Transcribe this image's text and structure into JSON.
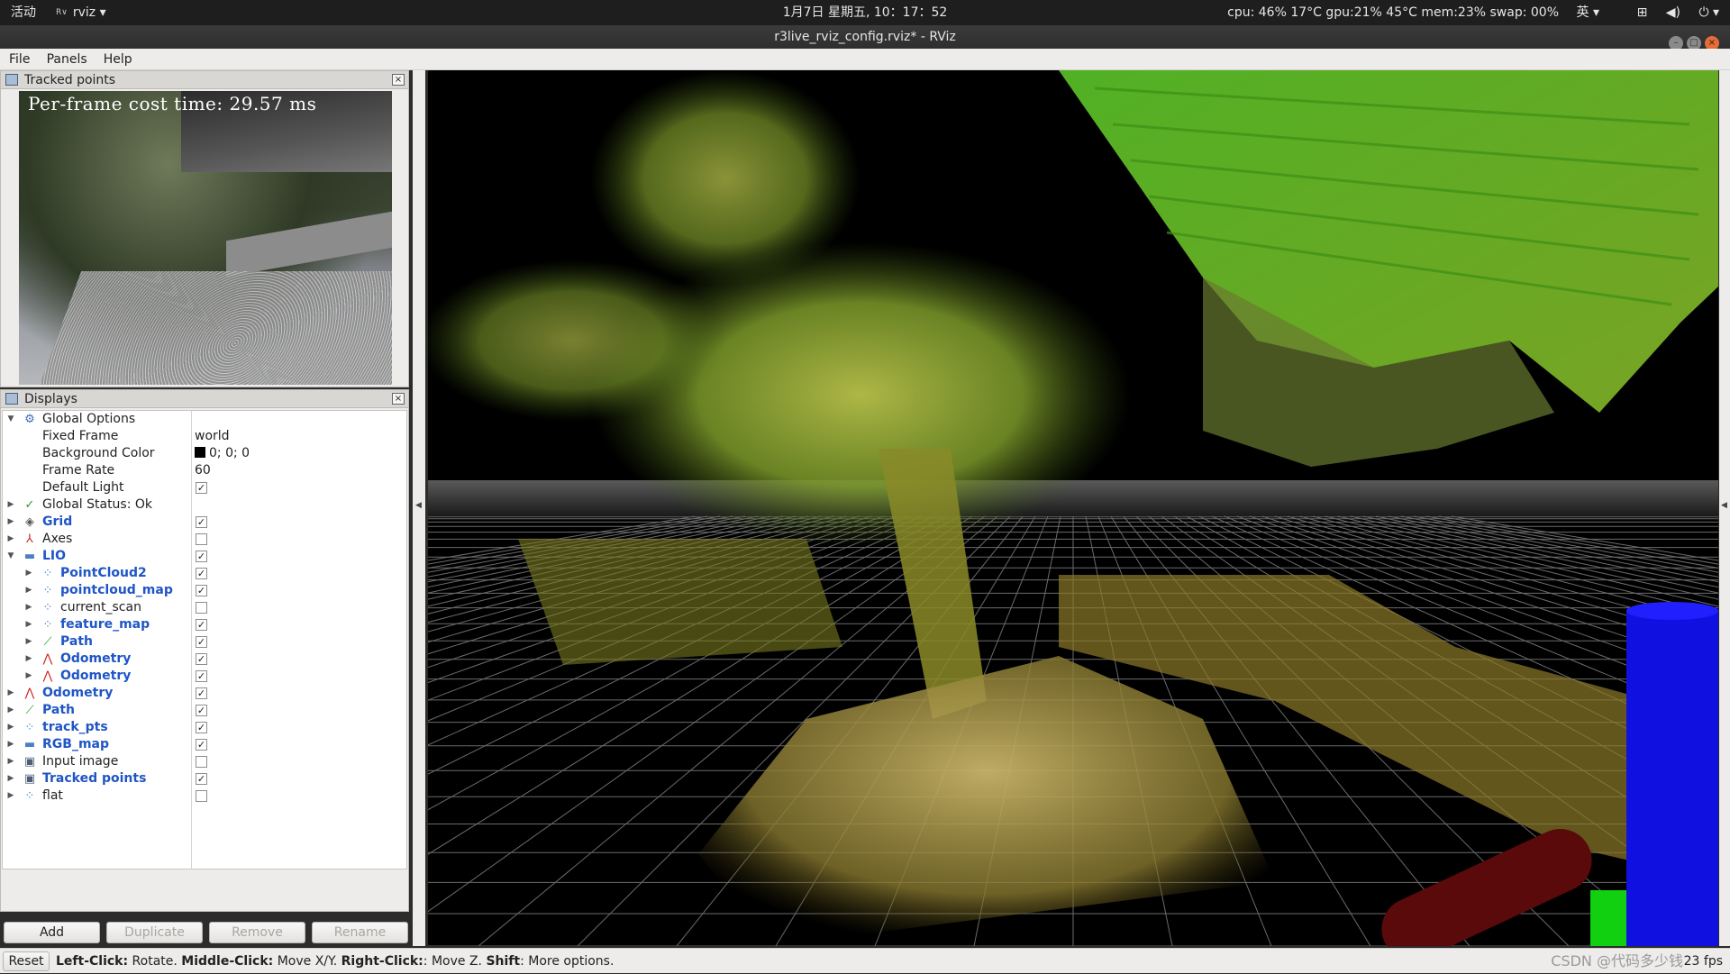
{
  "topbar": {
    "activities": "活动",
    "app_name": "rviz",
    "app_dropdown": "▾",
    "clock": "1月7日 星期五, 10：17：52",
    "system_stats": "cpu: 46% 17°C gpu:21% 45°C mem:23% swap: 00%",
    "ime": "英 ▾",
    "network_icon": "network-icon",
    "volume_icon": "volume-icon",
    "power_icon": "power-icon"
  },
  "window": {
    "title": "r3live_rviz_config.rviz* - RViz"
  },
  "menu": {
    "file": "File",
    "panels": "Panels",
    "help": "Help"
  },
  "tracked_points_panel": {
    "title": "Tracked points",
    "overlay_text": "Per-frame cost time: 29.57 ms"
  },
  "displays_panel": {
    "title": "Displays",
    "global_options": {
      "label": "Global Options",
      "fixed_frame_label": "Fixed Frame",
      "fixed_frame_value": "world",
      "background_color_label": "Background Color",
      "background_color_value": "0; 0; 0",
      "frame_rate_label": "Frame Rate",
      "frame_rate_value": "60",
      "default_light_label": "Default Light"
    },
    "global_status": "Global Status: Ok",
    "items": [
      {
        "label": "Grid",
        "checked": true,
        "bold": true
      },
      {
        "label": "Axes",
        "checked": false,
        "bold": false
      },
      {
        "label": "LIO",
        "checked": true,
        "bold": true
      },
      {
        "label": "PointCloud2",
        "checked": true,
        "bold": true
      },
      {
        "label": "pointcloud_map",
        "checked": true,
        "bold": true
      },
      {
        "label": "current_scan",
        "checked": false,
        "bold": false
      },
      {
        "label": "feature_map",
        "checked": true,
        "bold": true
      },
      {
        "label": "Path",
        "checked": true,
        "bold": true
      },
      {
        "label": "Odometry",
        "checked": true,
        "bold": true
      },
      {
        "label": "Odometry",
        "checked": true,
        "bold": true
      },
      {
        "label": "Odometry",
        "checked": true,
        "bold": true
      },
      {
        "label": "Path",
        "checked": true,
        "bold": true
      },
      {
        "label": "track_pts",
        "checked": true,
        "bold": true
      },
      {
        "label": "RGB_map",
        "checked": true,
        "bold": true
      },
      {
        "label": "Input image",
        "checked": false,
        "bold": false
      },
      {
        "label": "Tracked points",
        "checked": true,
        "bold": true
      },
      {
        "label": "flat",
        "checked": false,
        "bold": false
      }
    ],
    "buttons": {
      "add": "Add",
      "duplicate": "Duplicate",
      "remove": "Remove",
      "rename": "Rename"
    }
  },
  "statusbar": {
    "reset": "Reset",
    "left_click_key": "Left-Click:",
    "left_click_desc": " Rotate. ",
    "middle_click_key": "Middle-Click:",
    "middle_click_desc": " Move X/Y. ",
    "right_click_key": "Right-Click:",
    "right_click_desc": ": Move Z. ",
    "shift_key": "Shift",
    "shift_desc": ": More options.",
    "fps": "23 fps",
    "watermark": "CSDN @代码多少钱"
  },
  "colors": {
    "grid_line": "#6b6b6b",
    "cloud_green": "#6fb82a",
    "cloud_yellow": "#a8a030",
    "axis_blue": "#1010e0",
    "axis_green": "#10d010",
    "axis_red": "#a01010"
  }
}
